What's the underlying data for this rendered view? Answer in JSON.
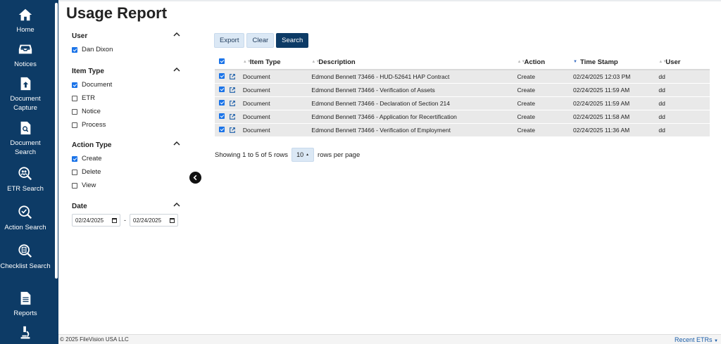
{
  "sidebar": {
    "items": [
      {
        "label": "Home",
        "icon": "home-icon"
      },
      {
        "label": "Notices",
        "icon": "inbox-icon"
      },
      {
        "label": "Document Capture",
        "icon": "upload-document-icon"
      },
      {
        "label": "Document Search",
        "icon": "document-search-icon"
      },
      {
        "label": "ETR Search",
        "icon": "people-search-icon"
      },
      {
        "label": "Action Search",
        "icon": "check-search-icon"
      },
      {
        "label": "Checklist Search",
        "icon": "clipboard-search-icon"
      },
      {
        "label": "Reports",
        "icon": "report-icon"
      },
      {
        "label": "",
        "icon": "microscope-icon"
      }
    ]
  },
  "page": {
    "title": "Usage Report"
  },
  "filters": {
    "user": {
      "heading": "User",
      "options": [
        {
          "label": "Dan Dixon",
          "checked": true
        }
      ]
    },
    "item_type": {
      "heading": "Item Type",
      "options": [
        {
          "label": "Document",
          "checked": true
        },
        {
          "label": "ETR",
          "checked": false
        },
        {
          "label": "Notice",
          "checked": false
        },
        {
          "label": "Process",
          "checked": false
        }
      ]
    },
    "action_type": {
      "heading": "Action Type",
      "options": [
        {
          "label": "Create",
          "checked": true
        },
        {
          "label": "Delete",
          "checked": false
        },
        {
          "label": "View",
          "checked": false
        }
      ]
    },
    "date": {
      "heading": "Date",
      "from": "02/24/2025",
      "separator": "-",
      "to": "02/24/2025"
    }
  },
  "toolbar": {
    "export_label": "Export",
    "clear_label": "Clear",
    "search_label": "Search"
  },
  "table": {
    "columns": [
      "Item Type",
      "Description",
      "Action",
      "Time Stamp",
      "User"
    ],
    "rows": [
      {
        "item_type": "Document",
        "description": "Edmond Bennett 73466 - HUD-52641 HAP Contract",
        "action": "Create",
        "timestamp": "02/24/2025 12:03 PM",
        "user": "dd"
      },
      {
        "item_type": "Document",
        "description": "Edmond Bennett 73466 - Verification of Assets",
        "action": "Create",
        "timestamp": "02/24/2025 11:59 AM",
        "user": "dd"
      },
      {
        "item_type": "Document",
        "description": "Edmond Bennett 73466 - Declaration of Section 214",
        "action": "Create",
        "timestamp": "02/24/2025 11:59 AM",
        "user": "dd"
      },
      {
        "item_type": "Document",
        "description": "Edmond Bennett 73466 - Application for Recertification",
        "action": "Create",
        "timestamp": "02/24/2025 11:58 AM",
        "user": "dd"
      },
      {
        "item_type": "Document",
        "description": "Edmond Bennett 73466 - Verification of Employment",
        "action": "Create",
        "timestamp": "02/24/2025 11:36 AM",
        "user": "dd"
      }
    ]
  },
  "pagination": {
    "summary": "Showing 1 to 5 of 5 rows",
    "per_page": "10",
    "per_page_suffix": "rows per page"
  },
  "footer": {
    "copyright": "© 2025 FileVision USA LLC",
    "recent": "Recent ETRs"
  },
  "colors": {
    "sidebar": "#0d3b66",
    "accent": "#1a73e8",
    "row_bg": "#e9e9e9",
    "button_light": "#dbe8f5"
  }
}
